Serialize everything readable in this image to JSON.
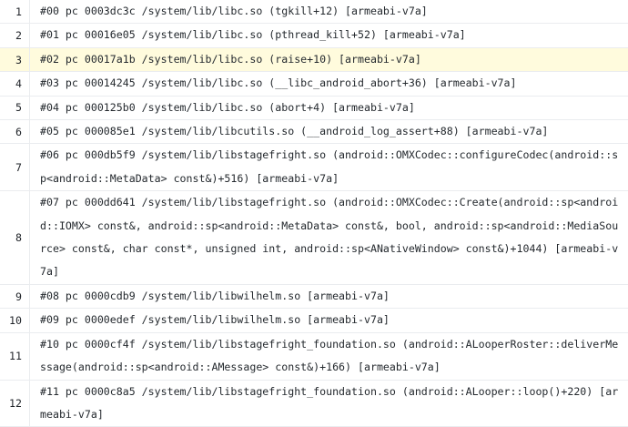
{
  "highlight_line": 3,
  "highlight_color": "#fffbdd",
  "lines": [
    {
      "num": "1",
      "text": "#00 pc 0003dc3c /system/lib/libc.so (tgkill+12) [armeabi-v7a]"
    },
    {
      "num": "2",
      "text": "#01 pc 00016e05 /system/lib/libc.so (pthread_kill+52) [armeabi-v7a]"
    },
    {
      "num": "3",
      "text": "#02 pc 00017a1b /system/lib/libc.so (raise+10) [armeabi-v7a]"
    },
    {
      "num": "4",
      "text": "#03 pc 00014245 /system/lib/libc.so (__libc_android_abort+36) [armeabi-v7a]"
    },
    {
      "num": "5",
      "text": "#04 pc 000125b0 /system/lib/libc.so (abort+4) [armeabi-v7a]"
    },
    {
      "num": "6",
      "text": "#05 pc 000085e1 /system/lib/libcutils.so (__android_log_assert+88) [armeabi-v7a]"
    },
    {
      "num": "7",
      "text": "#06 pc 000db5f9 /system/lib/libstagefright.so (android::OMXCodec::configureCodec(android::sp<android::MetaData> const&)+516) [armeabi-v7a]"
    },
    {
      "num": "8",
      "text": "#07 pc 000dd641 /system/lib/libstagefright.so (android::OMXCodec::Create(android::sp<android::IOMX> const&, android::sp<android::MetaData> const&, bool, android::sp<android::MediaSource> const&, char const*, unsigned int, android::sp<ANativeWindow> const&)+1044) [armeabi-v7a]"
    },
    {
      "num": "9",
      "text": "#08 pc 0000cdb9 /system/lib/libwilhelm.so [armeabi-v7a]"
    },
    {
      "num": "10",
      "text": "#09 pc 0000edef /system/lib/libwilhelm.so [armeabi-v7a]"
    },
    {
      "num": "11",
      "text": "#10 pc 0000cf4f /system/lib/libstagefright_foundation.so (android::ALooperRoster::deliverMessage(android::sp<android::AMessage> const&)+166) [armeabi-v7a]"
    },
    {
      "num": "12",
      "text": "#11 pc 0000c8a5 /system/lib/libstagefright_foundation.so (android::ALooper::loop()+220) [armeabi-v7a]"
    }
  ]
}
